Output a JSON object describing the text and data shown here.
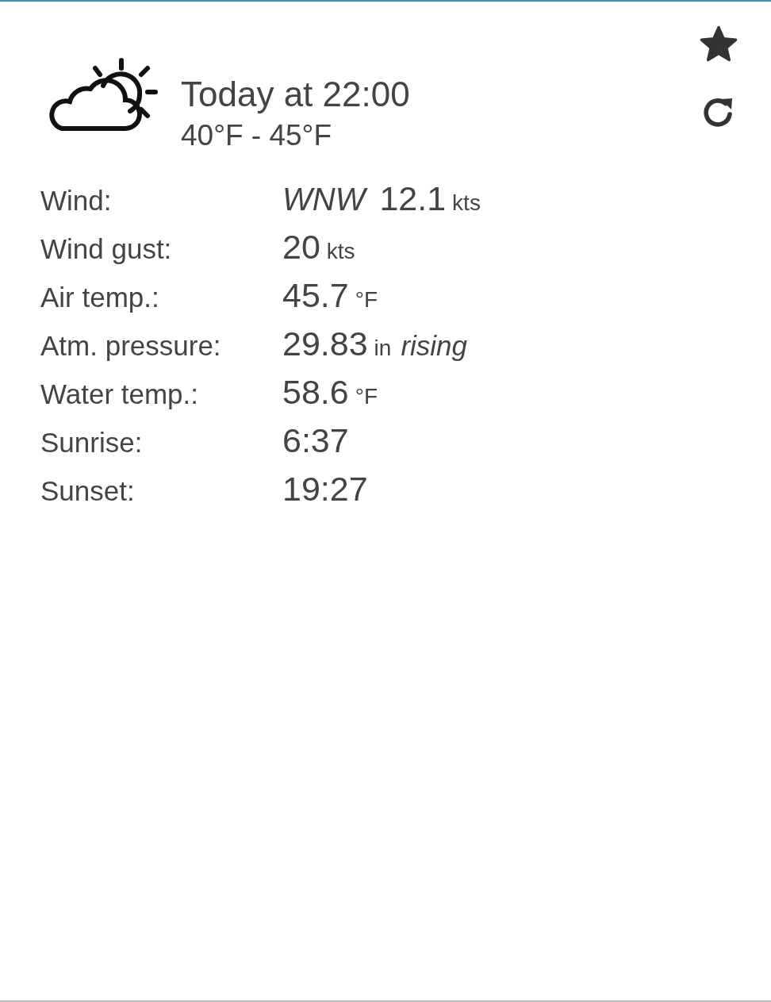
{
  "header": {
    "title": "Today at 22:00",
    "range": "40°F - 45°F",
    "favorite": true
  },
  "rows": [
    {
      "label": "Wind:",
      "parts": [
        {
          "kind": "italic",
          "text": "WNW"
        },
        {
          "kind": "number",
          "text": "12.1"
        },
        {
          "kind": "unit",
          "text": "kts"
        }
      ]
    },
    {
      "label": "Wind gust:",
      "parts": [
        {
          "kind": "number",
          "text": "20"
        },
        {
          "kind": "unit",
          "text": "kts"
        }
      ]
    },
    {
      "label": "Air temp.:",
      "parts": [
        {
          "kind": "number",
          "text": "45.7"
        },
        {
          "kind": "unit",
          "text": "°F"
        }
      ]
    },
    {
      "label": "Atm. pressure:",
      "parts": [
        {
          "kind": "number",
          "text": "29.83"
        },
        {
          "kind": "unit",
          "text": "in"
        },
        {
          "kind": "italic",
          "text": "rising"
        }
      ]
    },
    {
      "label": "Water temp.:",
      "parts": [
        {
          "kind": "number",
          "text": "58.6"
        },
        {
          "kind": "unit",
          "text": "°F"
        }
      ]
    },
    {
      "label": "Sunrise:",
      "parts": [
        {
          "kind": "number",
          "text": "6:37"
        }
      ]
    },
    {
      "label": "Sunset:",
      "parts": [
        {
          "kind": "number",
          "text": "19:27"
        }
      ]
    }
  ]
}
